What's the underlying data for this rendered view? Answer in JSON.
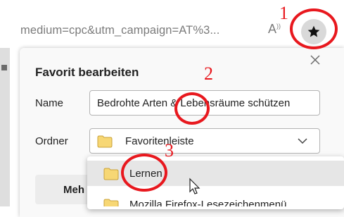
{
  "address_bar": {
    "url_text": "medium=cpc&utm_campaign=AT%3...",
    "read_aloud_label": "A"
  },
  "dialog": {
    "title": "Favorit bearbeiten",
    "name_label": "Name",
    "name_value": "Bedrohte Arten & Lebensräume schützen",
    "folder_label": "Ordner",
    "folder_value": "Favoritenleiste",
    "more_button_label": "Meh"
  },
  "dropdown": {
    "items": [
      {
        "label": "Lernen"
      },
      {
        "label": "Mozilla Firefox-Lesezeichenmenü"
      }
    ]
  },
  "annotations": {
    "step1": "1",
    "step2": "2",
    "step3": "3",
    "color": "#e8181e"
  },
  "icons": [
    "star-icon",
    "close-icon",
    "folder-icon",
    "chevron-down-icon",
    "mouse-cursor-icon",
    "read-aloud-icon"
  ]
}
